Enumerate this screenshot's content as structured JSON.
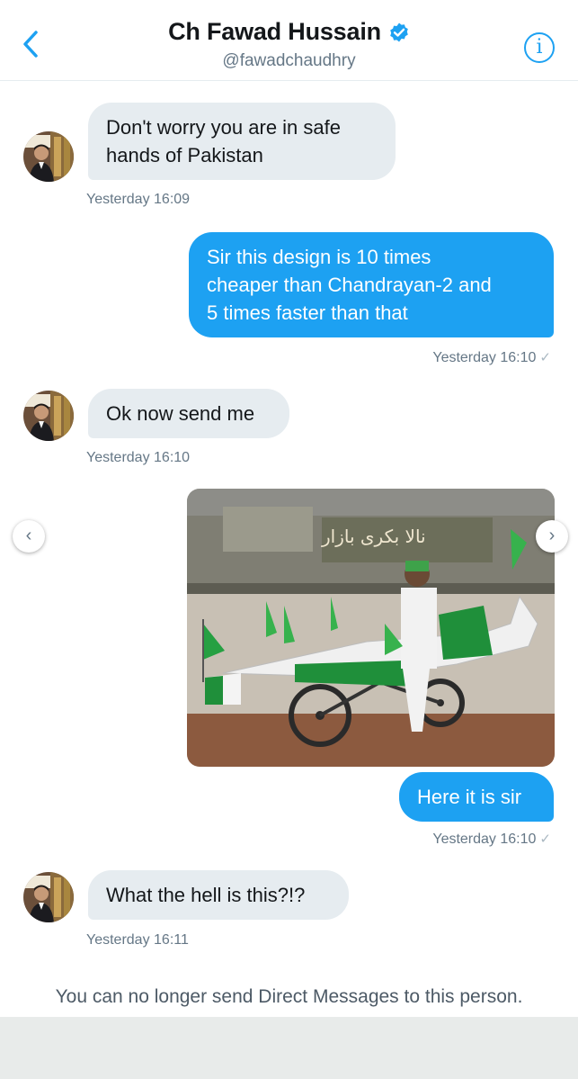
{
  "header": {
    "name": "Ch Fawad Hussain",
    "handle": "@fawadchaudhry",
    "back_icon": "chevron-left-icon",
    "info_icon": "info-icon",
    "info_glyph": "i",
    "verified_icon": "verified-badge-icon"
  },
  "messages": [
    {
      "from": "them",
      "text_lines": [
        "Don't worry you are in safe",
        "hands of Pakistan"
      ],
      "time": "Yesterday 16:09"
    },
    {
      "from": "me",
      "text_lines": [
        "Sir this design is 10 times",
        "cheaper than Chandrayan-2 and",
        "5 times faster than that"
      ],
      "time": "Yesterday 16:10"
    },
    {
      "from": "them",
      "text_lines": [
        "Ok now send me"
      ],
      "time": "Yesterday 16:10"
    },
    {
      "from": "me",
      "type": "photo",
      "caption": "Here it is sir",
      "time": "Yesterday 16:10"
    },
    {
      "from": "them",
      "text_lines": [
        "What the hell is this?!?"
      ],
      "time": "Yesterday 16:11"
    }
  ],
  "photo_signboard_text": "نالا بکری بازار",
  "carousel": {
    "prev_glyph": "‹",
    "next_glyph": "›"
  },
  "read_check": "✓",
  "notice": "You can no longer send Direct Messages to this person.",
  "colors": {
    "accent": "#1da1f2",
    "incoming_bubble": "#e6ecf0",
    "timestamp": "#657786",
    "footer": "#e8ebea"
  }
}
